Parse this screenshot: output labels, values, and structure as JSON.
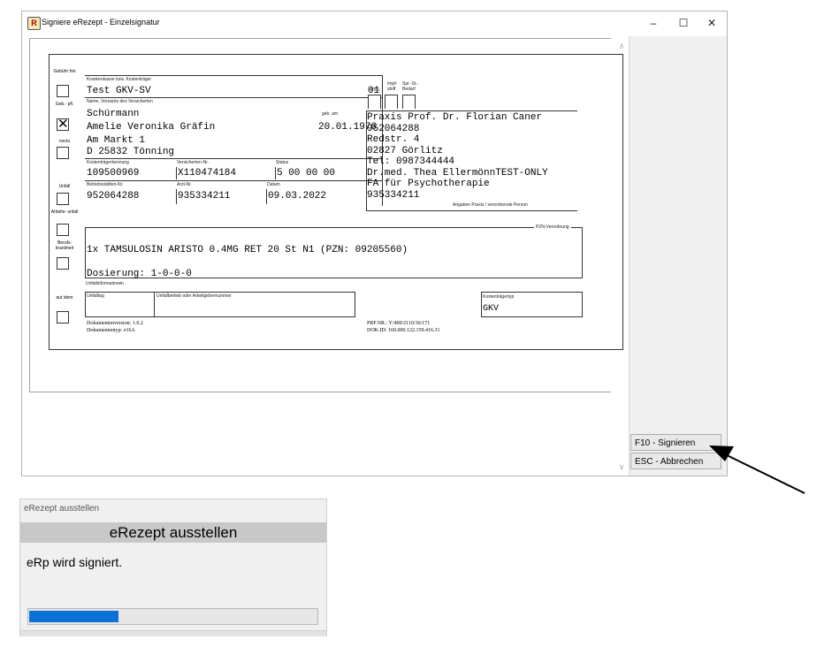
{
  "window": {
    "title": "Signiere eRezept - Einzelsignatur",
    "app_icon": "R",
    "minimize": "–",
    "maximize": "☐",
    "close": "✕"
  },
  "buttons": {
    "sign": "F10 - Signieren",
    "cancel": "ESC - Abbrechen"
  },
  "scroll": {
    "up": "∧",
    "down": "∨"
  },
  "form": {
    "side": {
      "gebuehr_frei": "Gebühr frei",
      "geb_pfl": "Geb.- pfl.",
      "noctu": "noctu",
      "unfall": "Unfall",
      "arbeitsunfall": "Arbeits- unfall",
      "berufskrankheit": "Berufs- krankheit",
      "aut_idem": "aut idem",
      "check_mark": "✕"
    },
    "kasse_label": "Krankenkasse bzw. Kostenträger",
    "kasse": "Test GKV-SV",
    "kasse_nr": "01",
    "name_label": "Name, Vorname des Versicherten",
    "geb_label": "geb. am",
    "lastname": "Schürmann",
    "firstname": "Amelie Veronika Gräfin",
    "birthdate": "20.01.1976",
    "street": "Am Markt 1",
    "city": "D 25832 Tönning",
    "kostentraeger_label": "Kostenträgerkennung",
    "versicherten_label": "Versicherten-Nr.",
    "status_label": "Status",
    "kostentraeger": "109500969",
    "versicherten": "X110474184",
    "status": "5 00 00 00",
    "betriebsstaette_label": "Betriebsstätten-Nr.",
    "arzt_label": "Arzt-Nr.",
    "datum_label": "Datum",
    "betriebsstaette": "952064288",
    "arzt": "935334211",
    "datum": "09.03.2022",
    "bvg_label": "BVG",
    "impf_label": "Impf- stoff",
    "spr_label": "Spr.-St.- Bedarf",
    "praxis_lines": [
      "Praxis Prof. Dr. Florian Caner",
      "952064288",
      "Redstr.  4",
      "02827 Görlitz",
      "Tel: 0987344444",
      "Dr.med. Thea EllermönnTEST-ONLY",
      "FA für Psychotherapie",
      "935334211"
    ],
    "praxis_caption": "Angaben Praxis / verordnende Person",
    "pzn_label": "PZN-Verordnung",
    "medication": "1x TAMSULOSIN ARISTO 0.4MG RET 20 St N1 (PZN: 09205560)",
    "dosage": "Dosierung: 1-0-0-0",
    "unfall_info_label": "Unfallinformationen",
    "unfalltag_label": "Unfalltag",
    "unfallbetrieb_label": "Unfallbetrieb oder Arbeitgebernummer",
    "kostentraegertyp_label": "Kostenträgertyp",
    "kostentraegertyp": "GKV",
    "doc_version": "Dokumentenversion:  1.0.2",
    "doc_type": "Dokumententyp:  e16A",
    "prf_nr": "PRF.NR.:  Y/400/2110/36/171",
    "dok_id": "DOK.ID:  160.000.122.159.416.31"
  },
  "dialog": {
    "window_title": "eRezept ausstellen",
    "heading": "eRezept ausstellen",
    "message": "eRp wird signiert.",
    "progress": 0.31,
    "progress_color": "#0b71d6"
  }
}
